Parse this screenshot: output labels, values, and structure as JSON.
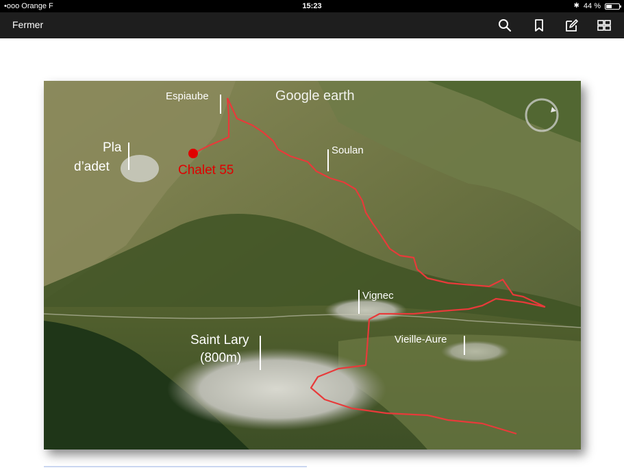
{
  "status_bar": {
    "carrier": "•ooo Orange F",
    "time": "15:23",
    "battery_text": "44 %",
    "battery_level": 0.44
  },
  "toolbar": {
    "close_label": "Fermer",
    "icons": [
      "search-icon",
      "bookmark-icon",
      "edit-icon",
      "grid-view-icon"
    ]
  },
  "map": {
    "watermark": "Google earth",
    "labels": {
      "espiaube": "Espiaube",
      "pla": "Pla",
      "adet": "d’adet",
      "chalet": "Chalet 55",
      "soulan": "Soulan",
      "vignec": "Vignec",
      "saint_lary": "Saint Lary",
      "altitude": "(800m)",
      "vieille_aure": "Vieille-Aure"
    },
    "colors": {
      "route": "#e83a3a",
      "chalet_marker": "#e00000",
      "label_text": "#ffffff"
    }
  }
}
